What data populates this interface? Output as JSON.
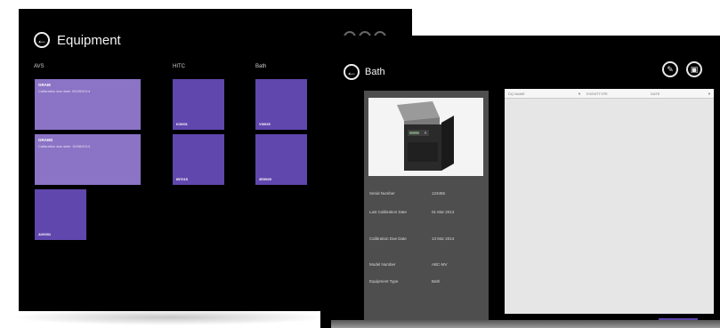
{
  "back_screen": {
    "title": "Equipment",
    "back_icon": "←",
    "groups": {
      "avs": {
        "label": "AVS",
        "tiles": [
          {
            "title": "GRAM",
            "subtitle": "Calibration due date: 09/25/2014"
          },
          {
            "title": "GRAM2",
            "subtitle": "Calibration due date: 10/08/2014"
          },
          {
            "code": "AV0001"
          }
        ]
      },
      "hitc": {
        "label": "HITC",
        "tiles": [
          {
            "code": "IC0001"
          },
          {
            "code": "IB7015"
          }
        ]
      },
      "bath": {
        "label": "Bath",
        "tiles": [
          {
            "code": "VI0025"
          },
          {
            "code": "3E0009"
          }
        ]
      }
    }
  },
  "front_screen": {
    "title": "Bath",
    "back_icon": "←",
    "edit_icon": "✎",
    "delete_icon": "▣",
    "properties": [
      {
        "key": "Serial Number",
        "value": "123456"
      },
      {
        "key": "Last Calibration Date",
        "value": "01 Mar 2013"
      },
      {
        "key": "Calibration Due Date",
        "value": "13 Mar 2014"
      },
      {
        "key": "Model Number",
        "value": "ABC-MV"
      },
      {
        "key": "Equipment Type",
        "value": "Bath"
      }
    ],
    "table": {
      "columns": [
        "DQ NAME",
        "EVENTTYPE",
        "DATE"
      ],
      "sort_icon": "▼"
    },
    "print_label": "Print"
  }
}
